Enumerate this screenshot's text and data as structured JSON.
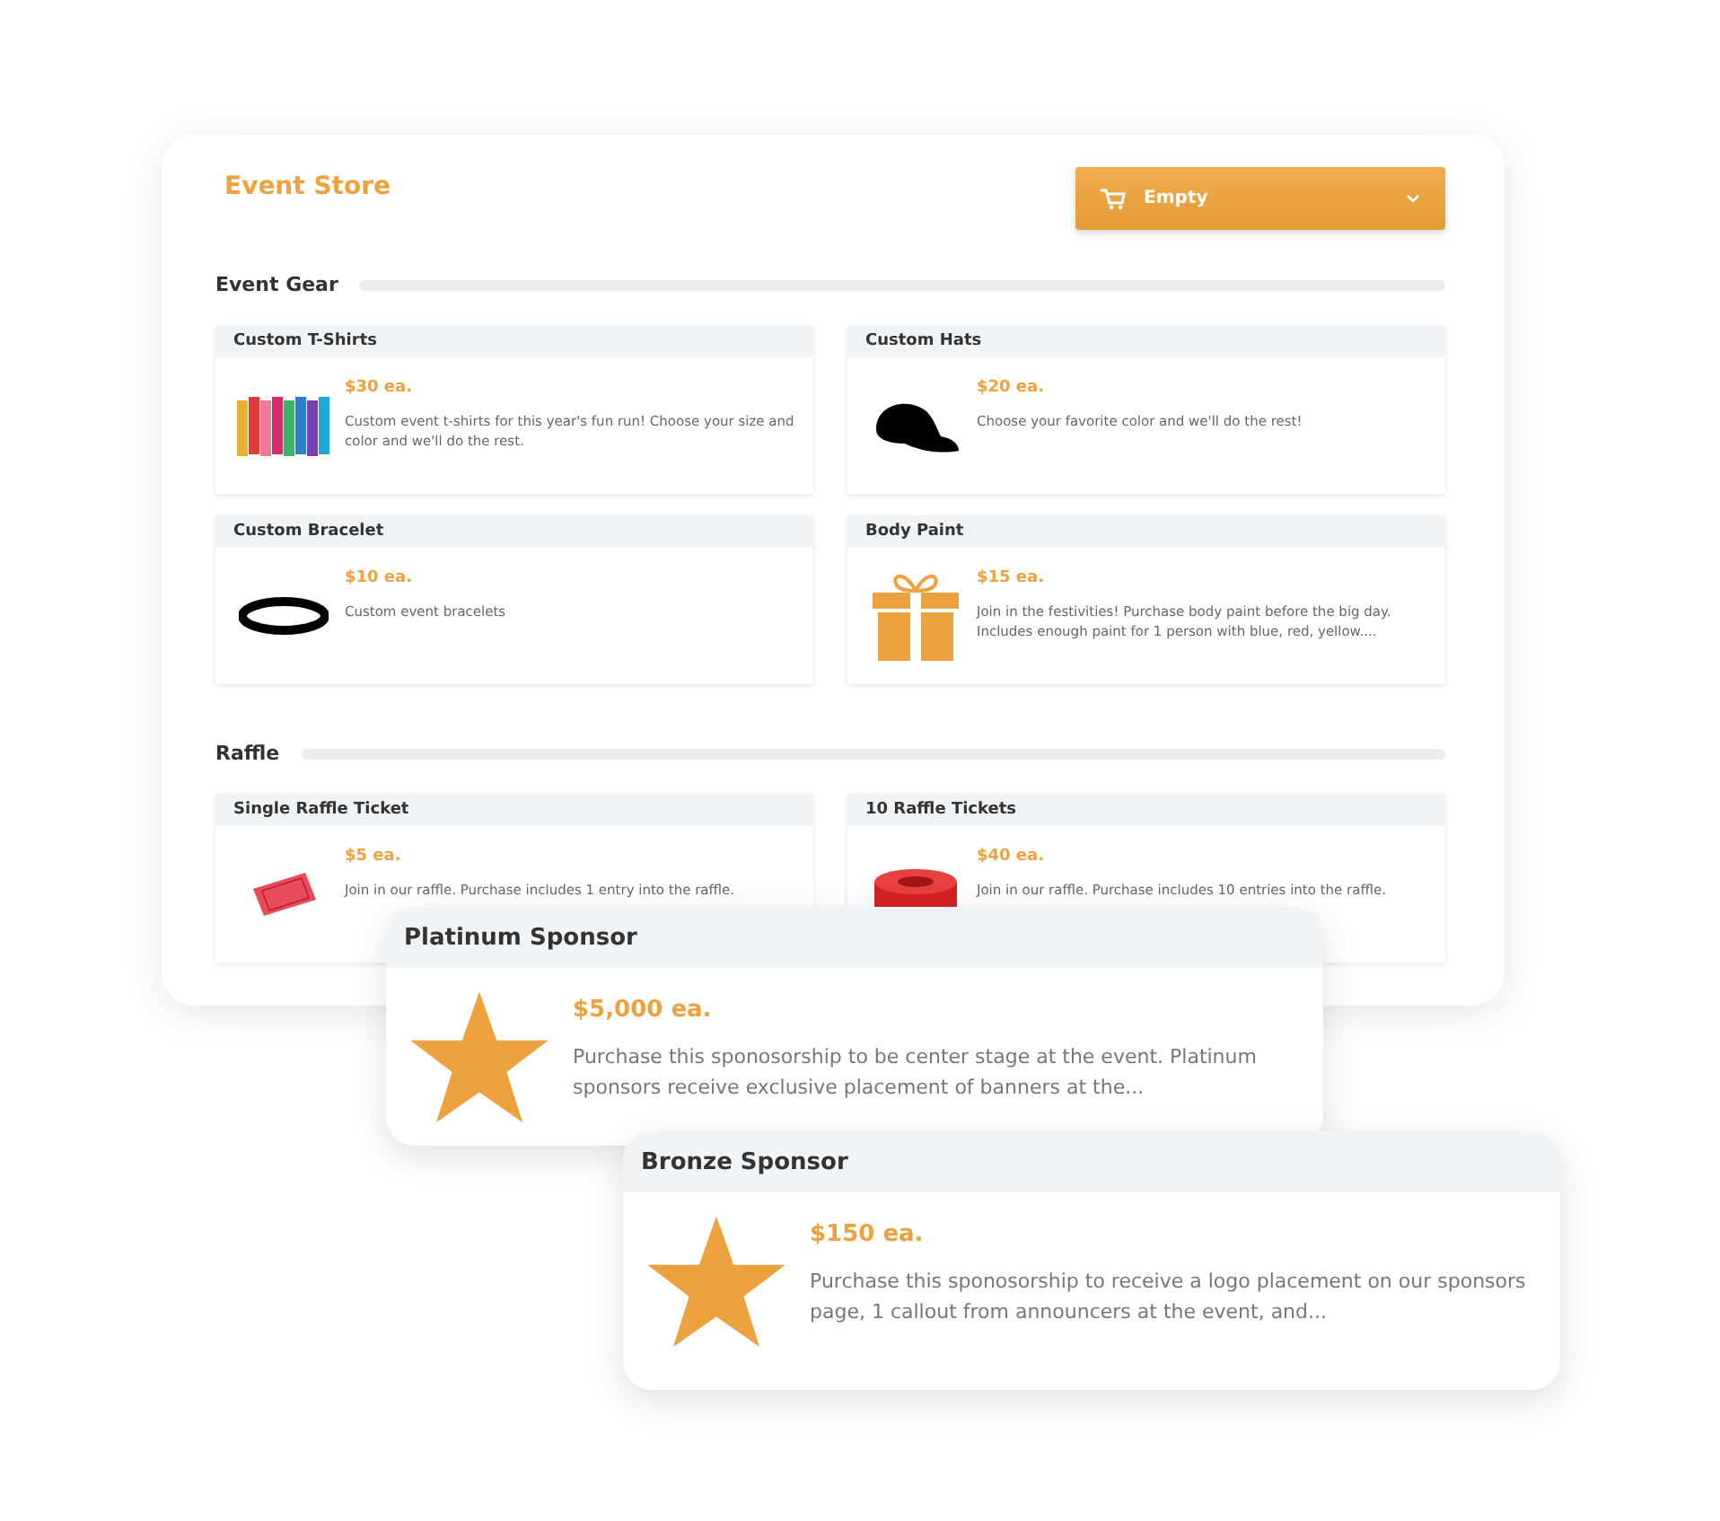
{
  "store": {
    "title": "Event Store",
    "cart": {
      "label": "Empty"
    }
  },
  "sections": [
    {
      "title": "Event Gear",
      "items": [
        {
          "name": "Custom T-Shirts",
          "price": "$30 ea.",
          "description": "Custom event t-shirts for this year's fun run! Choose your size and color and we'll do the rest.",
          "kind": "tshirts"
        },
        {
          "name": "Custom Hats",
          "price": "$20 ea.",
          "description": "Choose your favorite color and we'll do the rest!",
          "kind": "hat"
        },
        {
          "name": "Custom Bracelet",
          "price": "$10 ea.",
          "description": "Custom event bracelets",
          "kind": "bracelet"
        },
        {
          "name": "Body Paint",
          "price": "$15 ea.",
          "description": "Join in the festivities! Purchase body paint before the big day. Includes enough paint for 1 person with blue, red, yellow....",
          "kind": "gift"
        }
      ]
    },
    {
      "title": "Raffle",
      "items": [
        {
          "name": "Single Raffle Ticket",
          "price": "$5 ea.",
          "description": "Join in our raffle. Purchase includes 1 entry into the raffle.",
          "kind": "ticket"
        },
        {
          "name": "10 Raffle Tickets",
          "price": "$40 ea.",
          "description": "Join in our raffle. Purchase includes 10 entries into the raffle.",
          "kind": "roll"
        }
      ]
    }
  ],
  "sponsors": [
    {
      "name": "Platinum Sponsor",
      "price": "$5,000 ea.",
      "description": "Purchase this sponosorship to be center stage at the event. Platinum sponsors receive exclusive placement of banners at the..."
    },
    {
      "name": "Bronze Sponsor",
      "price": "$150 ea.",
      "description": "Purchase this sponosorship to receive a logo placement on our sponsors page, 1 callout from announcers at the event, and..."
    }
  ]
}
